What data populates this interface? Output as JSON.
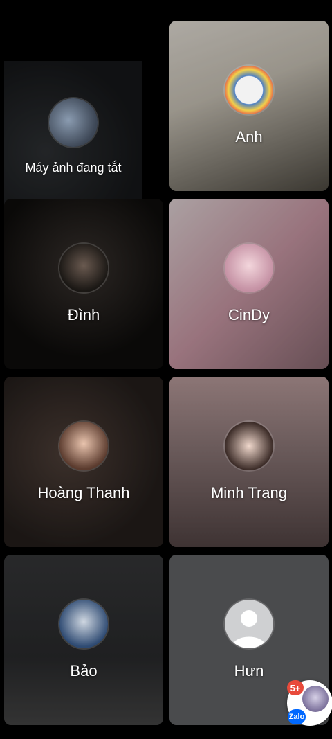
{
  "tiles": [
    {
      "name": "Máy ảnh đang tắt",
      "avatar": "camera-off-user"
    },
    {
      "name": "Anh",
      "avatar": "shinchan-car"
    },
    {
      "name": "Đình",
      "avatar": "male-dark"
    },
    {
      "name": "CinDy",
      "avatar": "girl-pink"
    },
    {
      "name": "Hoàng Thanh",
      "avatar": "boy-smile"
    },
    {
      "name": "Minh Trang",
      "avatar": "girl-bunny"
    },
    {
      "name": "Bảo",
      "avatar": "boy-blue"
    },
    {
      "name": "Hưn",
      "avatar": "default-user-icon"
    }
  ],
  "floating_chat": {
    "badge": "5+",
    "app_label": "Zalo"
  }
}
